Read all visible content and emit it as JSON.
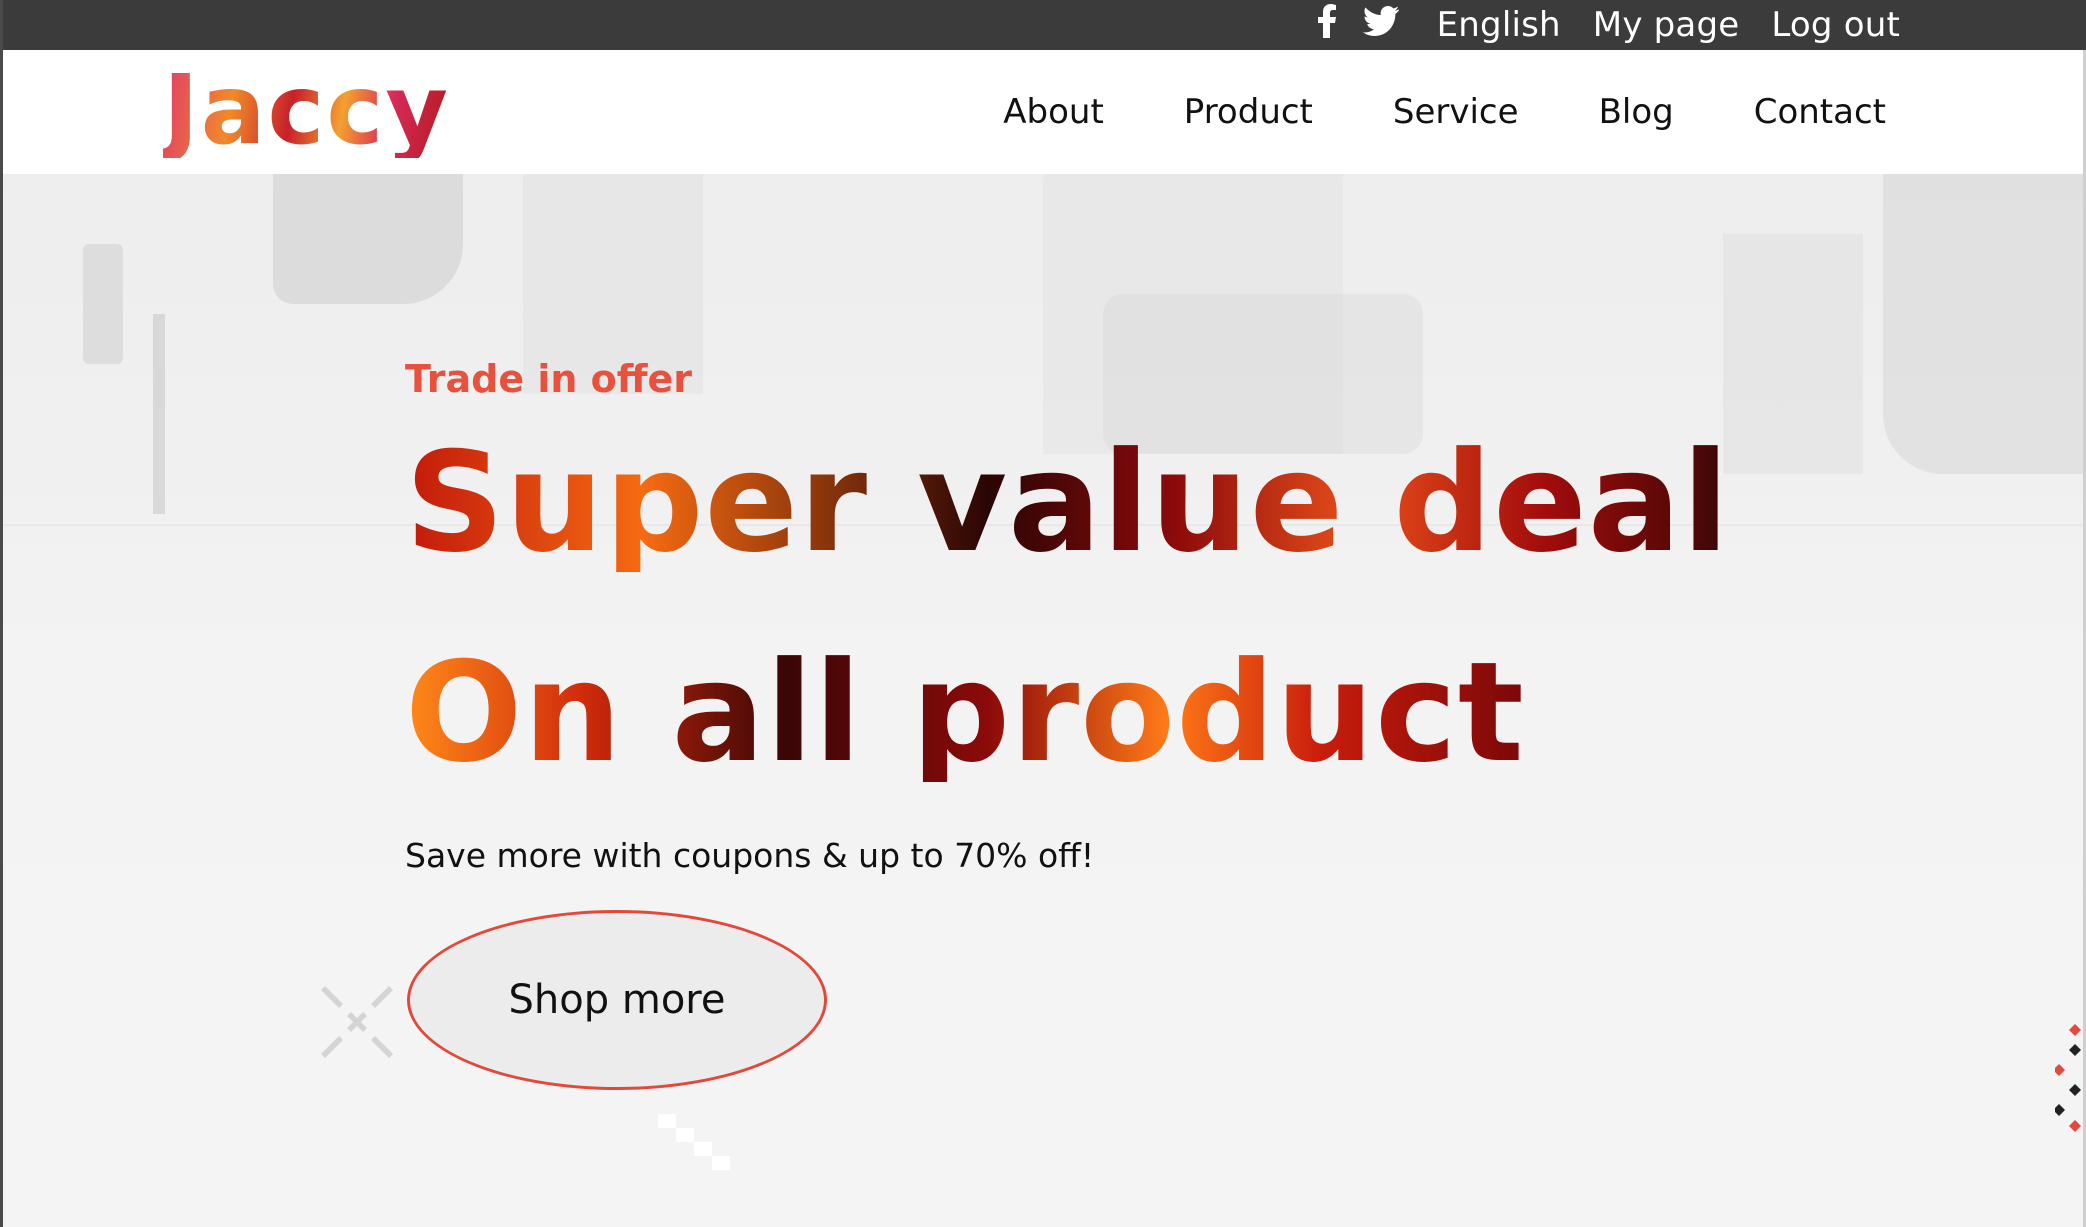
{
  "topbar": {
    "social": {
      "facebook_icon": "facebook-icon",
      "twitter_icon": "twitter-icon"
    },
    "links": {
      "language": "English",
      "my_page": "My page",
      "logout": "Log out"
    }
  },
  "header": {
    "logo": "Jaccy",
    "nav": [
      "About",
      "Product",
      "Service",
      "Blog",
      "Contact"
    ]
  },
  "hero": {
    "kicker": "Trade in offer",
    "headline_line1": "Super value deal",
    "headline_line2": "On all product",
    "subtext": "Save more with coupons & up to 70% off!",
    "cta": "Shop more"
  },
  "colors": {
    "accent": "#e7513d",
    "topbar": "#3b3b3b",
    "background": "#f5f5f5"
  }
}
